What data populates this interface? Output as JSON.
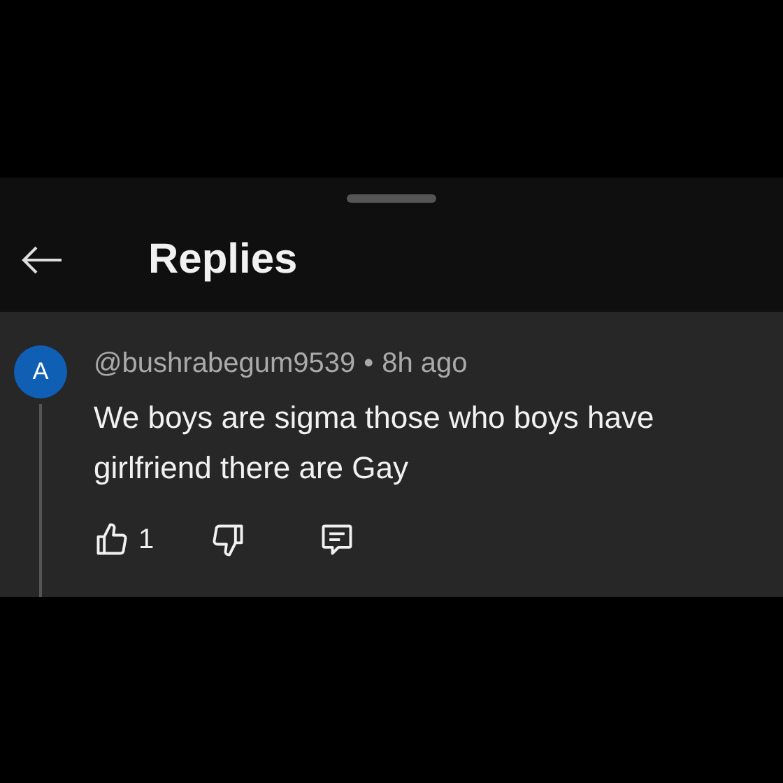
{
  "header": {
    "title": "Replies"
  },
  "comment": {
    "avatar_letter": "A",
    "author": "@bushrabegum9539",
    "separator": "•",
    "time": "8h ago",
    "text": "We boys are sigma those who boys have girlfriend there are Gay",
    "likes": "1"
  }
}
